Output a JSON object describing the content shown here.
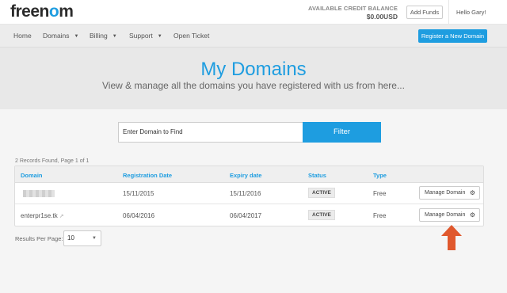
{
  "header": {
    "logo_part1": "freen",
    "logo_part2": "o",
    "logo_part3": "m",
    "credit_label": "AVAILABLE CREDIT BALANCE",
    "credit_amount": "$0.00USD",
    "add_funds": "Add Funds",
    "greeting": "Hello Gary!"
  },
  "nav": {
    "items": [
      {
        "label": "Home"
      },
      {
        "label": "Domains"
      },
      {
        "label": "Billing"
      },
      {
        "label": "Support"
      },
      {
        "label": "Open Ticket"
      }
    ],
    "register_label": "Register a New Domain"
  },
  "hero": {
    "title": "My Domains",
    "subtitle": "View & manage all the domains you have registered with us from here..."
  },
  "filter": {
    "placeholder": "Enter Domain to Find",
    "button": "Filter"
  },
  "records_text": "2 Records Found, Page 1 of 1",
  "table": {
    "headers": [
      "Domain",
      "Registration Date",
      "Expiry date",
      "Status",
      "Type"
    ],
    "rows": [
      {
        "domain": "",
        "reg_date": "15/11/2015",
        "exp_date": "15/11/2016",
        "status": "ACTIVE",
        "type": "Free",
        "action": "Manage Domain"
      },
      {
        "domain": "enterpr1se.tk",
        "reg_date": "06/04/2016",
        "exp_date": "06/04/2017",
        "status": "ACTIVE",
        "type": "Free",
        "action": "Manage Domain"
      }
    ]
  },
  "pagination": {
    "label": "Results Per Page:",
    "value": "10"
  },
  "colors": {
    "accent": "#1e9de0",
    "arrow": "#e0582d"
  }
}
